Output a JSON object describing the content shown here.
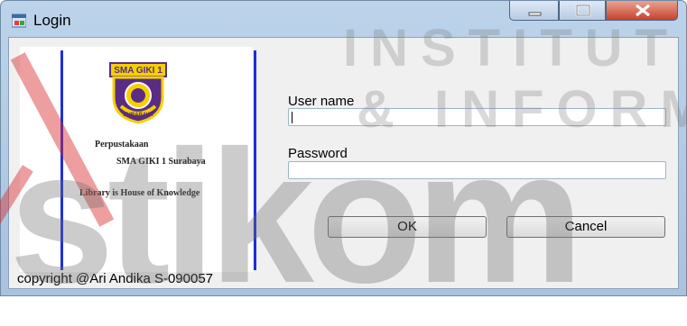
{
  "window": {
    "title": "Login"
  },
  "brand_panel": {
    "logo_text": "SMA GIKI 1",
    "logo_lower": "SURABAYA",
    "line1": "Perpustakaan",
    "line2": "SMA GIKI 1 Surabaya",
    "line3": "Library is House of Knowledge"
  },
  "form": {
    "username_label": "User name",
    "username_value": "",
    "password_label": "Password",
    "password_value": "",
    "ok_label": "OK",
    "cancel_label": "Cancel"
  },
  "footer": {
    "copyright": "copyright @Ari Andika S-090057"
  },
  "watermark": {
    "line1": "INSTITUT B",
    "line2": "& INFORMA",
    "word": "stikom"
  },
  "colors": {
    "accent_blue": "#1f2fd6",
    "logo_purple": "#5b2c83",
    "logo_yellow": "#f5d000",
    "watermark_red": "#d62b2b"
  }
}
